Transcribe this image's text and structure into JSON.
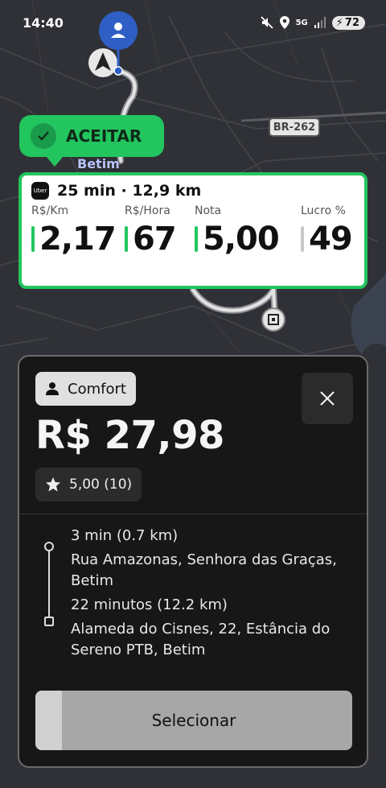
{
  "status": {
    "time": "14:40",
    "network": "5G",
    "battery": "72"
  },
  "map": {
    "city": "Betim",
    "road": "BR-262"
  },
  "accept": {
    "label": "ACEITAR"
  },
  "info": {
    "brand": "Uber",
    "summary": "25 min · 12,9 km",
    "metrics": [
      {
        "label": "R$/Km",
        "value": "2,17"
      },
      {
        "label": "R$/Hora",
        "value": "67"
      },
      {
        "label": "Nota",
        "value": "5,00"
      },
      {
        "label": "Lucro %",
        "value": "49"
      }
    ]
  },
  "ride": {
    "category": "Comfort",
    "price": "R$ 27,98",
    "rating": "5,00 (10)",
    "pickup_eta": "3 min (0.7 km)",
    "pickup_address": "Rua Amazonas, Senhora das Graças, Betim",
    "trip_eta": "22 minutos (12.2 km)",
    "dropoff_address": "Alameda do Cisnes, 22, Estância do Sereno PTB, Betim",
    "select_label": "Selecionar",
    "select_progress": 0.085
  },
  "colors": {
    "accent": "#22c55e",
    "pin": "#2f5fc4",
    "map_bg": "#303136"
  }
}
